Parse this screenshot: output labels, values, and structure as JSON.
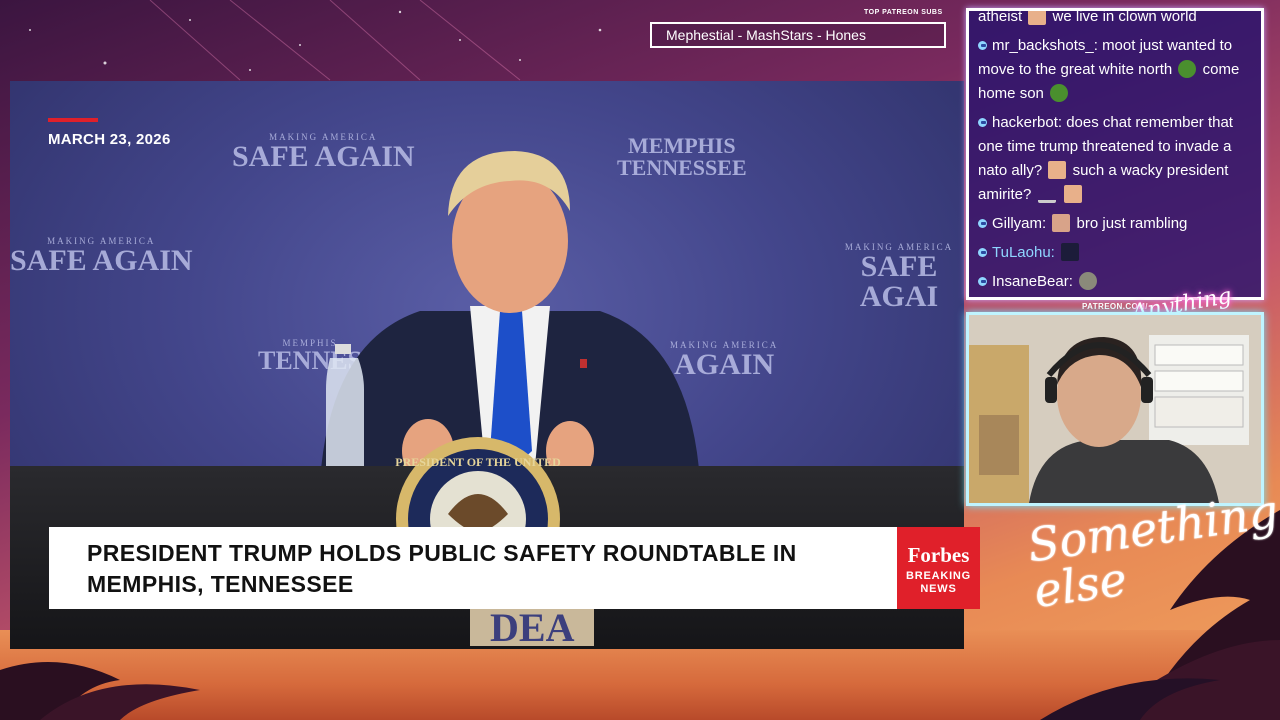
{
  "ticker": {
    "label": "TOP PATREON SUBS",
    "text": "Mephestial - MashStars - Hones"
  },
  "video": {
    "date": "MARCH 23, 2026",
    "backdrop": {
      "making_america": "MAKING AMERICA",
      "safe_again": "SAFE AGAIN",
      "memphis": "MEMPHIS",
      "tennessee": "TENNESSEE",
      "again": "AGAIN",
      "safe_again_right": "SAFE AGAI",
      "tennes": "TENNES"
    },
    "seal_text": "PRESIDENT OF THE UNITED",
    "podium_text": "DEA",
    "headline": "PRESIDENT TRUMP HOLDS PUBLIC SAFETY ROUNDTABLE IN MEMPHIS, TENNESSEE",
    "forbes_logo": "Forbes",
    "breaking_news": "BREAKING NEWS"
  },
  "chat": {
    "messages": [
      {
        "user": "",
        "text": "atheist",
        "text2": "we live in clown world"
      },
      {
        "user": "mr_backshots_:",
        "text": "moot just wanted to move to the great white north",
        "text2": "come home son"
      },
      {
        "user": "hackerbot:",
        "text": "does chat remember that one time trump threatened to invade a nato ally?",
        "text2": "such a wacky president amirite?"
      },
      {
        "user": "Gillyam:",
        "text": "bro just rambling"
      },
      {
        "user": "TuLaohu:",
        "text": ""
      },
      {
        "user": "InsaneBear:",
        "text": ""
      }
    ],
    "username_colors": {
      "TuLaohu": "#8fd6ff",
      "default": "#ffffff"
    }
  },
  "overlay": {
    "patreon_url": "PATREON.COM/",
    "anything_else": "Anything else",
    "signature": "Something else"
  },
  "colors": {
    "accent_red": "#e0202a",
    "chat_bg": "#28146e",
    "cam_border": "#bff4ff"
  }
}
